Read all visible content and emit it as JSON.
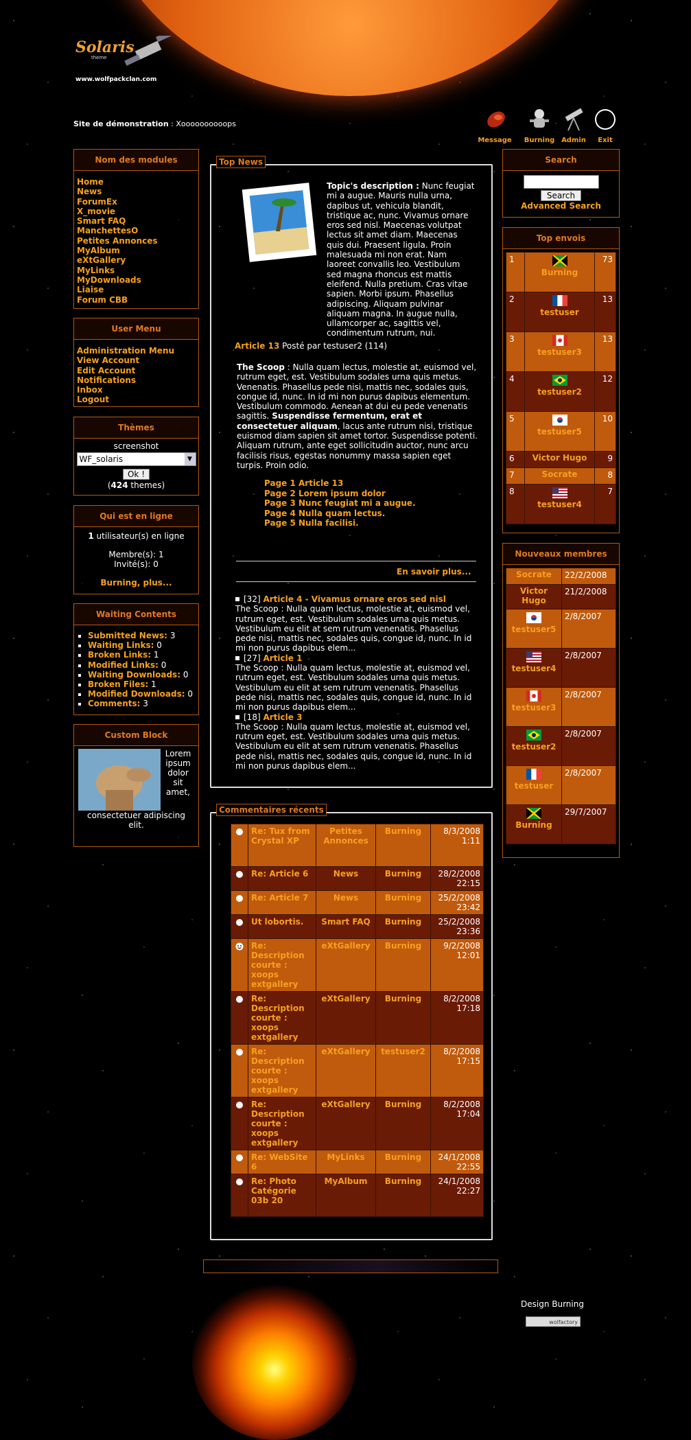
{
  "header": {
    "logo": "Solaris",
    "logo_sub": "theme",
    "site_url": "www.wolfpackclan.com",
    "demo_label": "Site de démonstration",
    "demo_sep": " : ",
    "demo_value": "Xoooooooooops",
    "icons": [
      {
        "label": "Message",
        "icon": "comet-icon"
      },
      {
        "label": "Burning",
        "icon": "astronaut-icon"
      },
      {
        "label": "Admin",
        "icon": "telescope-icon"
      },
      {
        "label": "Exit",
        "icon": "eclipse-icon"
      }
    ]
  },
  "modules": {
    "title": "Nom des modules",
    "items": [
      "Home",
      "News",
      "ForumEx",
      "X_movie",
      "Smart FAQ",
      "ManchettesO",
      "Petites Annonces",
      "MyAlbum",
      "eXtGallery",
      "MyLinks",
      "MyDownloads",
      "Liaise",
      "Forum CBB"
    ]
  },
  "user_menu": {
    "title": "User Menu",
    "items": [
      "Administration Menu",
      "View Account",
      "Edit Account",
      "Notifications",
      "Inbox",
      "Logout"
    ]
  },
  "themes": {
    "title": "Thèmes",
    "screenshot_label": "screenshot",
    "selected": "WF_solaris",
    "ok_label": "Ok !",
    "count": "424",
    "count_suffix": " themes)",
    "count_prefix": "("
  },
  "online": {
    "title": "Qui est en ligne",
    "count": "1",
    "count_text": " utilisateur(s) en ligne",
    "members": "Membre(s): 1",
    "guests": "Invité(s): 0",
    "more": "Burning, plus..."
  },
  "waiting": {
    "title": "Waiting Contents",
    "items": [
      {
        "label": "Submitted News:",
        "value": "3"
      },
      {
        "label": "Waiting Links:",
        "value": "0"
      },
      {
        "label": "Broken Links:",
        "value": "1"
      },
      {
        "label": "Modified Links:",
        "value": "0"
      },
      {
        "label": "Waiting Downloads:",
        "value": "0"
      },
      {
        "label": "Broken Files:",
        "value": "1"
      },
      {
        "label": "Modified Downloads:",
        "value": "0"
      },
      {
        "label": "Comments:",
        "value": "3"
      }
    ]
  },
  "custom": {
    "title": "Custom Block",
    "text": "Lorem ipsum dolor sit amet, consectetuer adipiscing elit."
  },
  "top_news": {
    "legend": "Top News",
    "desc_label": "Topic's description :",
    "desc_text": " Nunc feugiat mi a augue. Mauris nulla urna, dapibus ut, vehicula blandit, tristique ac, nunc. Vivamus ornare eros sed nisl. Maecenas volutpat lectus sit amet diam. Maecenas quis dui. Praesent ligula. Proin malesuada mi non erat. Nam laoreet convallis leo. Vestibulum sed magna rhoncus est mattis eleifend. Nulla pretium. Cras vitae sapien. Morbi ipsum. Phasellus adipiscing. Aliquam pulvinar aliquam magna. In augue nulla, ullamcorper ac, sagittis vel, condimentum rutrum, nui.",
    "article_title": "Article 13",
    "posted_by": " Posté par testuser2 (114)",
    "scoop_label": "The Scoop",
    "scoop_text1": " : Nulla quam lectus, molestie at, euismod vel, rutrum eget, est. Vestibulum sodales urna quis metus. Venenatis. Phasellus pede nisi, mattis nec, sodales quis, congue id, nunc. In id mi non purus dapibus elementum. Vestibulum commodo. Aenean at dui eu pede venenatis sagittis. ",
    "scoop_bold": "Suspendisse fermentum, erat et consectetuer aliquam",
    "scoop_text2": ", lacus ante rutrum nisi, tristique euismod diam sapien sit amet tortor. Suspendisse potenti. Aliquam rutrum, ante eget sollicitudin auctor, nunc arcu facilisis risus, egestas nonummy massa sapien eget turpis. Proin odio.",
    "pages": [
      "Page 1 Article 13",
      "Page 2 Lorem ipsum dolor",
      "Page 3 Nunc feugiat mi a augue.",
      "Page 4 Nulla quam lectus.",
      "Page 5 Nulla facilisi."
    ],
    "read_more": "En savoir plus...",
    "list": [
      {
        "count": "[32]",
        "title": "Article 4 - Vivamus ornare eros sed nisl",
        "text": "The Scoop : Nulla quam lectus, molestie at, euismod vel, rutrum eget, est. Vestibulum sodales urna quis metus. Vestibulum eu elit at sem rutrum venenatis. Phasellus pede nisi, mattis nec, sodales quis, congue id, nunc. In id mi non purus dapibus elem..."
      },
      {
        "count": "[27]",
        "title": "Article 1",
        "text": "The Scoop : Nulla quam lectus, molestie at, euismod vel, rutrum eget, est. Vestibulum sodales urna quis metus. Vestibulum eu elit at sem rutrum venenatis. Phasellus pede nisi, mattis nec, sodales quis, congue id, nunc. In id mi non purus dapibus elem..."
      },
      {
        "count": "[18]",
        "title": "Article 3",
        "text": "The Scoop : Nulla quam lectus, molestie at, euismod vel, rutrum eget, est. Vestibulum sodales urna quis metus. Vestibulum eu elit at sem rutrum venenatis. Phasellus pede nisi, mattis nec, sodales quis, congue id, nunc. In id mi non purus dapibus elem..."
      }
    ]
  },
  "comments": {
    "legend": "Commentaires récents",
    "rows": [
      {
        "icon": "dot",
        "title": "Re: Tux from Crystal XP",
        "module": "Petites Annonces",
        "user": "Burning",
        "date": "8/3/2008 1:11"
      },
      {
        "icon": "dot",
        "title": "Re: Article 6",
        "module": "News",
        "user": "Burning",
        "date": "28/2/2008 22:15"
      },
      {
        "icon": "dot",
        "title": "Re: Article 7",
        "module": "News",
        "user": "Burning",
        "date": "25/2/2008 23:42"
      },
      {
        "icon": "dot",
        "title": "Ut lobortis.",
        "module": "Smart FAQ",
        "user": "Burning",
        "date": "25/2/2008 23:36"
      },
      {
        "icon": "smile",
        "title": "Re: Description courte : xoops extgallery",
        "module": "eXtGallery",
        "user": "Burning",
        "date": "9/2/2008 12:01"
      },
      {
        "icon": "dot",
        "title": "Re: Description courte : xoops extgallery",
        "module": "eXtGallery",
        "user": "Burning",
        "date": "8/2/2008 17:18"
      },
      {
        "icon": "dot",
        "title": "Re: Description courte : xoops extgallery",
        "module": "eXtGallery",
        "user": "testuser2",
        "date": "8/2/2008 17:15"
      },
      {
        "icon": "dot",
        "title": "Re: Description courte : xoops extgallery",
        "module": "eXtGallery",
        "user": "Burning",
        "date": "8/2/2008 17:04"
      },
      {
        "icon": "dot",
        "title": "Re: WebSite 6",
        "module": "MyLinks",
        "user": "Burning",
        "date": "24/1/2008 22:55"
      },
      {
        "icon": "dot",
        "title": "Re: Photo Catégorie 03b 20",
        "module": "MyAlbum",
        "user": "Burning",
        "date": "24/1/2008 22:27"
      }
    ]
  },
  "search": {
    "title": "Search",
    "button": "Search",
    "advanced": "Advanced Search",
    "value": ""
  },
  "top_posters": {
    "title": "Top envois",
    "rows": [
      {
        "rank": "1",
        "name": "Burning",
        "count": "73",
        "flag": "jamaica"
      },
      {
        "rank": "2",
        "name": "testuser",
        "count": "13",
        "flag": "france"
      },
      {
        "rank": "3",
        "name": "testuser3",
        "count": "13",
        "flag": "canada"
      },
      {
        "rank": "4",
        "name": "testuser2",
        "count": "12",
        "flag": "brazil"
      },
      {
        "rank": "5",
        "name": "testuser5",
        "count": "10",
        "flag": "korea"
      },
      {
        "rank": "6",
        "name": "Victor Hugo",
        "count": "9",
        "flag": ""
      },
      {
        "rank": "7",
        "name": "Socrate",
        "count": "8",
        "flag": ""
      },
      {
        "rank": "8",
        "name": "testuser4",
        "count": "7",
        "flag": "usa"
      }
    ]
  },
  "new_members": {
    "title": "Nouveaux membres",
    "rows": [
      {
        "name": "Socrate",
        "date": "22/2/2008",
        "flag": ""
      },
      {
        "name": "Victor Hugo",
        "date": "21/2/2008",
        "flag": ""
      },
      {
        "name": "testuser5",
        "date": "2/8/2007",
        "flag": "korea"
      },
      {
        "name": "testuser4",
        "date": "2/8/2007",
        "flag": "usa"
      },
      {
        "name": "testuser3",
        "date": "2/8/2007",
        "flag": "canada"
      },
      {
        "name": "testuser2",
        "date": "2/8/2007",
        "flag": "brazil"
      },
      {
        "name": "testuser",
        "date": "2/8/2007",
        "flag": "france"
      },
      {
        "name": "Burning",
        "date": "29/7/2007",
        "flag": "jamaica"
      }
    ]
  },
  "footer": {
    "design": "Design Burning",
    "badge": "wolfactory"
  },
  "colors": {
    "accent": "#f5a020",
    "row_light": "#c05a0c",
    "row_dark": "#6a1b06",
    "border": "#b25a12"
  }
}
